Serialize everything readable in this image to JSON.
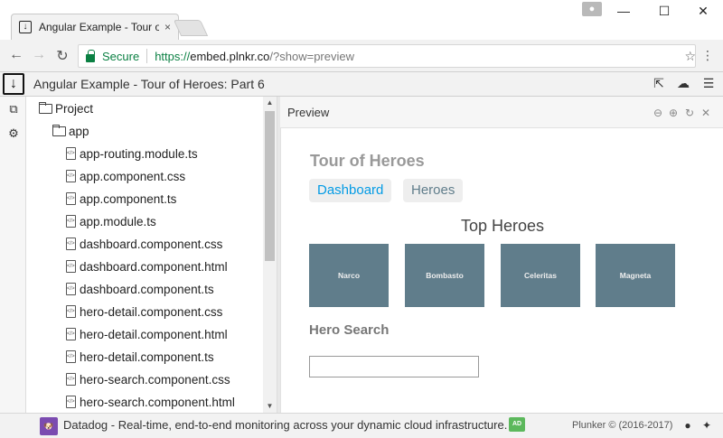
{
  "browser": {
    "tab_title": "Angular Example - Tour o",
    "tab_close": "×",
    "omnibox": {
      "secure_label": "Secure",
      "url_scheme": "https://",
      "url_host": "embed.plnkr.co",
      "url_path": "/?show=preview"
    },
    "window_controls": {
      "minimize": "—",
      "maximize": "☐",
      "close": "✕"
    }
  },
  "plunker": {
    "title": "Angular Example - Tour of Heroes: Part 6",
    "file_tree": {
      "root": "Project",
      "folder": "app",
      "files": [
        "app-routing.module.ts",
        "app.component.css",
        "app.component.ts",
        "app.module.ts",
        "dashboard.component.css",
        "dashboard.component.html",
        "dashboard.component.ts",
        "hero-detail.component.css",
        "hero-detail.component.html",
        "hero-detail.component.ts",
        "hero-search.component.css",
        "hero-search.component.html"
      ]
    },
    "preview_label": "Preview"
  },
  "app": {
    "title": "Tour of Heroes",
    "nav": {
      "dashboard": "Dashboard",
      "heroes": "Heroes"
    },
    "top_heroes_heading": "Top Heroes",
    "heroes": [
      "Narco",
      "Bombasto",
      "Celeritas",
      "Magneta"
    ],
    "hero_search_label": "Hero Search",
    "search_value": ""
  },
  "footer": {
    "ad_text": "Datadog - Real-time, end-to-end monitoring across your dynamic cloud infrastructure.",
    "ad_badge": "AD",
    "copyright": "Plunker © (2016-2017)"
  },
  "colors": {
    "secure_green": "#0b8043",
    "hero_tile": "#607d8b",
    "link_blue": "#039be5",
    "ad_green": "#5cb85c"
  }
}
